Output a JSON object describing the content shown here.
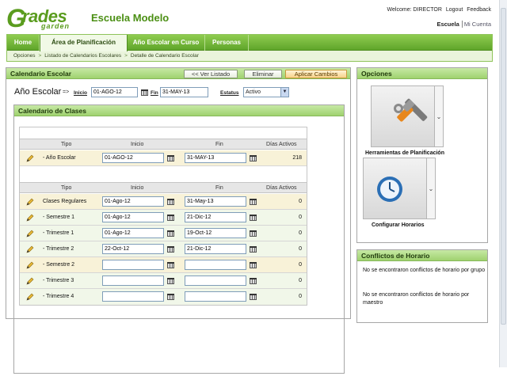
{
  "header": {
    "logo_main": "rades",
    "logo_g": "G",
    "logo_sub": "garden",
    "school": "Escuela Modelo",
    "welcome": "Welcome: DIRECTOR",
    "logout": "Logout",
    "feedback": "Feedback",
    "current_school": "Escuela",
    "my_account": "Mi Cuenta"
  },
  "nav": {
    "tabs": [
      "Home",
      "Área de Planificación",
      "Año Escolar en Curso",
      "Personas"
    ],
    "active_tab": "Área de Planificación",
    "breadcrumbs": [
      "Opciones",
      "Listado de Calendarios Escolares",
      "Detalle de Calendario Escolar"
    ]
  },
  "calendar_panel": {
    "title": "Calendario Escolar",
    "buttons": {
      "back": "<< Ver Listado",
      "delete": "Eliminar",
      "apply": "Aplicar Cambios"
    },
    "year_label": "Año Escolar",
    "arrow": "=>",
    "start_label": "Inicio",
    "start_value": "01-AGO-12",
    "end_label": "Fin",
    "end_value": "31-MAY-13",
    "status_label": "Estatus",
    "status_value": "Activo"
  },
  "classes": {
    "title": "Calendario de Clases",
    "columns": [
      "Tipo",
      "Inicio",
      "Fin",
      "Días Activos"
    ],
    "year_row": {
      "type": "- Año Escolar",
      "start": "01-AGO-12",
      "end": "31-MAY-13",
      "days": "218"
    },
    "rows": [
      {
        "type": "Clases Regulares",
        "start": "01-Ago-12",
        "end": "31-May-13",
        "days": "0"
      },
      {
        "type": "- Semestre 1",
        "start": "01-Ago-12",
        "end": "21-Dic-12",
        "days": "0"
      },
      {
        "type": "- Trimestre 1",
        "start": "01-Ago-12",
        "end": "19-Oct-12",
        "days": "0"
      },
      {
        "type": "- Trimestre 2",
        "start": "22-Oct-12",
        "end": "21-Dic-12",
        "days": "0"
      },
      {
        "type": "- Semestre 2",
        "start": "",
        "end": "",
        "days": "0"
      },
      {
        "type": "- Trimestre 3",
        "start": "",
        "end": "",
        "days": "0"
      },
      {
        "type": "- Trimestre 4",
        "start": "",
        "end": "",
        "days": "0"
      }
    ]
  },
  "options": {
    "title": "Opciones",
    "tools": [
      {
        "label": "Herramientas de Planificación",
        "icon": "tools-icon"
      },
      {
        "label": "Configurar Horarios",
        "icon": "clock-icon"
      }
    ]
  },
  "conflicts": {
    "title": "Conflictos de Horario",
    "messages": [
      "No se encontraron conflictos de horario por grupo",
      "No se encontraron conflictos de horario por maestro"
    ]
  },
  "colors": {
    "brand_green": "#5a9c1e",
    "tab_green": "#6fb535",
    "apply_orange": "#f7d28a"
  }
}
